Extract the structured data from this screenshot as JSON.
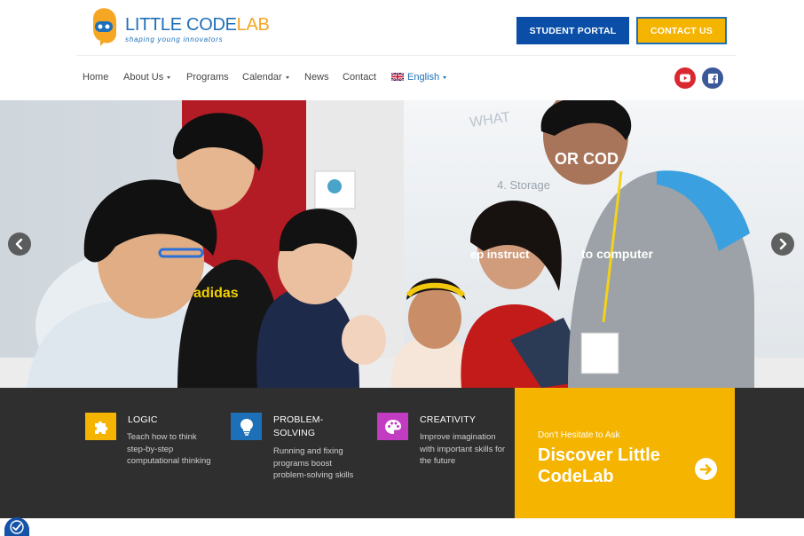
{
  "brand": {
    "name_part1": "LITTLE ",
    "name_part2": "CODE",
    "name_part3": "LAB",
    "tagline": "shaping young innovators",
    "colors": {
      "blue": "#1d6fb8",
      "orange": "#f5a623"
    }
  },
  "header": {
    "portal_label": "STUDENT PORTAL",
    "contact_label": "CONTACT US"
  },
  "nav": {
    "items": [
      {
        "label": "Home",
        "dropdown": false
      },
      {
        "label": "About Us",
        "dropdown": true
      },
      {
        "label": "Programs",
        "dropdown": false
      },
      {
        "label": "Calendar",
        "dropdown": true
      },
      {
        "label": "News",
        "dropdown": false
      },
      {
        "label": "Contact",
        "dropdown": false
      }
    ],
    "language": {
      "label": "English",
      "flag": "uk-flag-icon"
    },
    "social": [
      {
        "icon": "youtube-icon",
        "color": "#d9282f"
      },
      {
        "icon": "facebook-icon",
        "color": "#3b5998"
      }
    ]
  },
  "hero": {
    "image": "photo of children coding with an instructor",
    "prev_icon": "chevron-left-icon",
    "next_icon": "chevron-right-icon"
  },
  "features": [
    {
      "title": "LOGIC",
      "description": "Teach how to think step-by-step computational thinking",
      "icon": "puzzle-icon",
      "color": "#f5b400"
    },
    {
      "title": "PROBLEM-SOLVING",
      "description": "Running and fixing programs boost problem-solving skills",
      "icon": "lightbulb-icon",
      "color": "#1d6fb8"
    },
    {
      "title": "CREATIVITY",
      "description": "Improve imagination with important skills for the future",
      "icon": "palette-icon",
      "color": "#c13cc0"
    }
  ],
  "cta": {
    "subtitle": "Don't Hesitate to Ask",
    "title": "Discover Little CodeLab",
    "icon": "arrow-right-circle-icon",
    "color": "#f5b400"
  },
  "accessibility": {
    "icon": "accessibility-icon"
  }
}
